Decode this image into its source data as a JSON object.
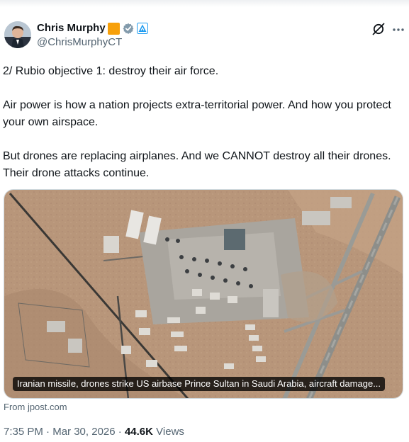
{
  "author": {
    "name": "Chris Murphy",
    "handle": "@ChrisMurphyCT",
    "colors": {
      "affiliate_badge": "#f7a00a",
      "verified_badge": "#829aab",
      "label_badge": "#1d9bf0"
    }
  },
  "icons": {
    "avatar": "avatar-photo",
    "affiliate": "orange-square-badge-icon",
    "verified": "gray-verified-check-icon",
    "affiliation": "blue-triangle-badge-icon",
    "grok": "grok-slash-circle-icon",
    "more": "ellipsis-icon"
  },
  "tweet": {
    "paragraphs": [
      "2/ Rubio objective 1: destroy their air force.",
      "Air power is how a nation projects extra-territorial power. And how you protect your own airspace.",
      "But drones are replacing airplanes. And we CANNOT destroy all their drones. Their drone attacks continue."
    ]
  },
  "card": {
    "image": "satellite-image-airbase",
    "caption": "Iranian missile, drones strike US airbase Prince Sultan in Saudi Arabia, aircraft damage...",
    "source": "From jpost.com"
  },
  "meta": {
    "time": "7:35 PM",
    "separator": "·",
    "date": "Mar 30, 2026",
    "views_count": "44.6K",
    "views_label": "Views"
  },
  "theme": {
    "text": "#0f1419",
    "secondary_text": "#536471",
    "border": "#cfd9de"
  }
}
